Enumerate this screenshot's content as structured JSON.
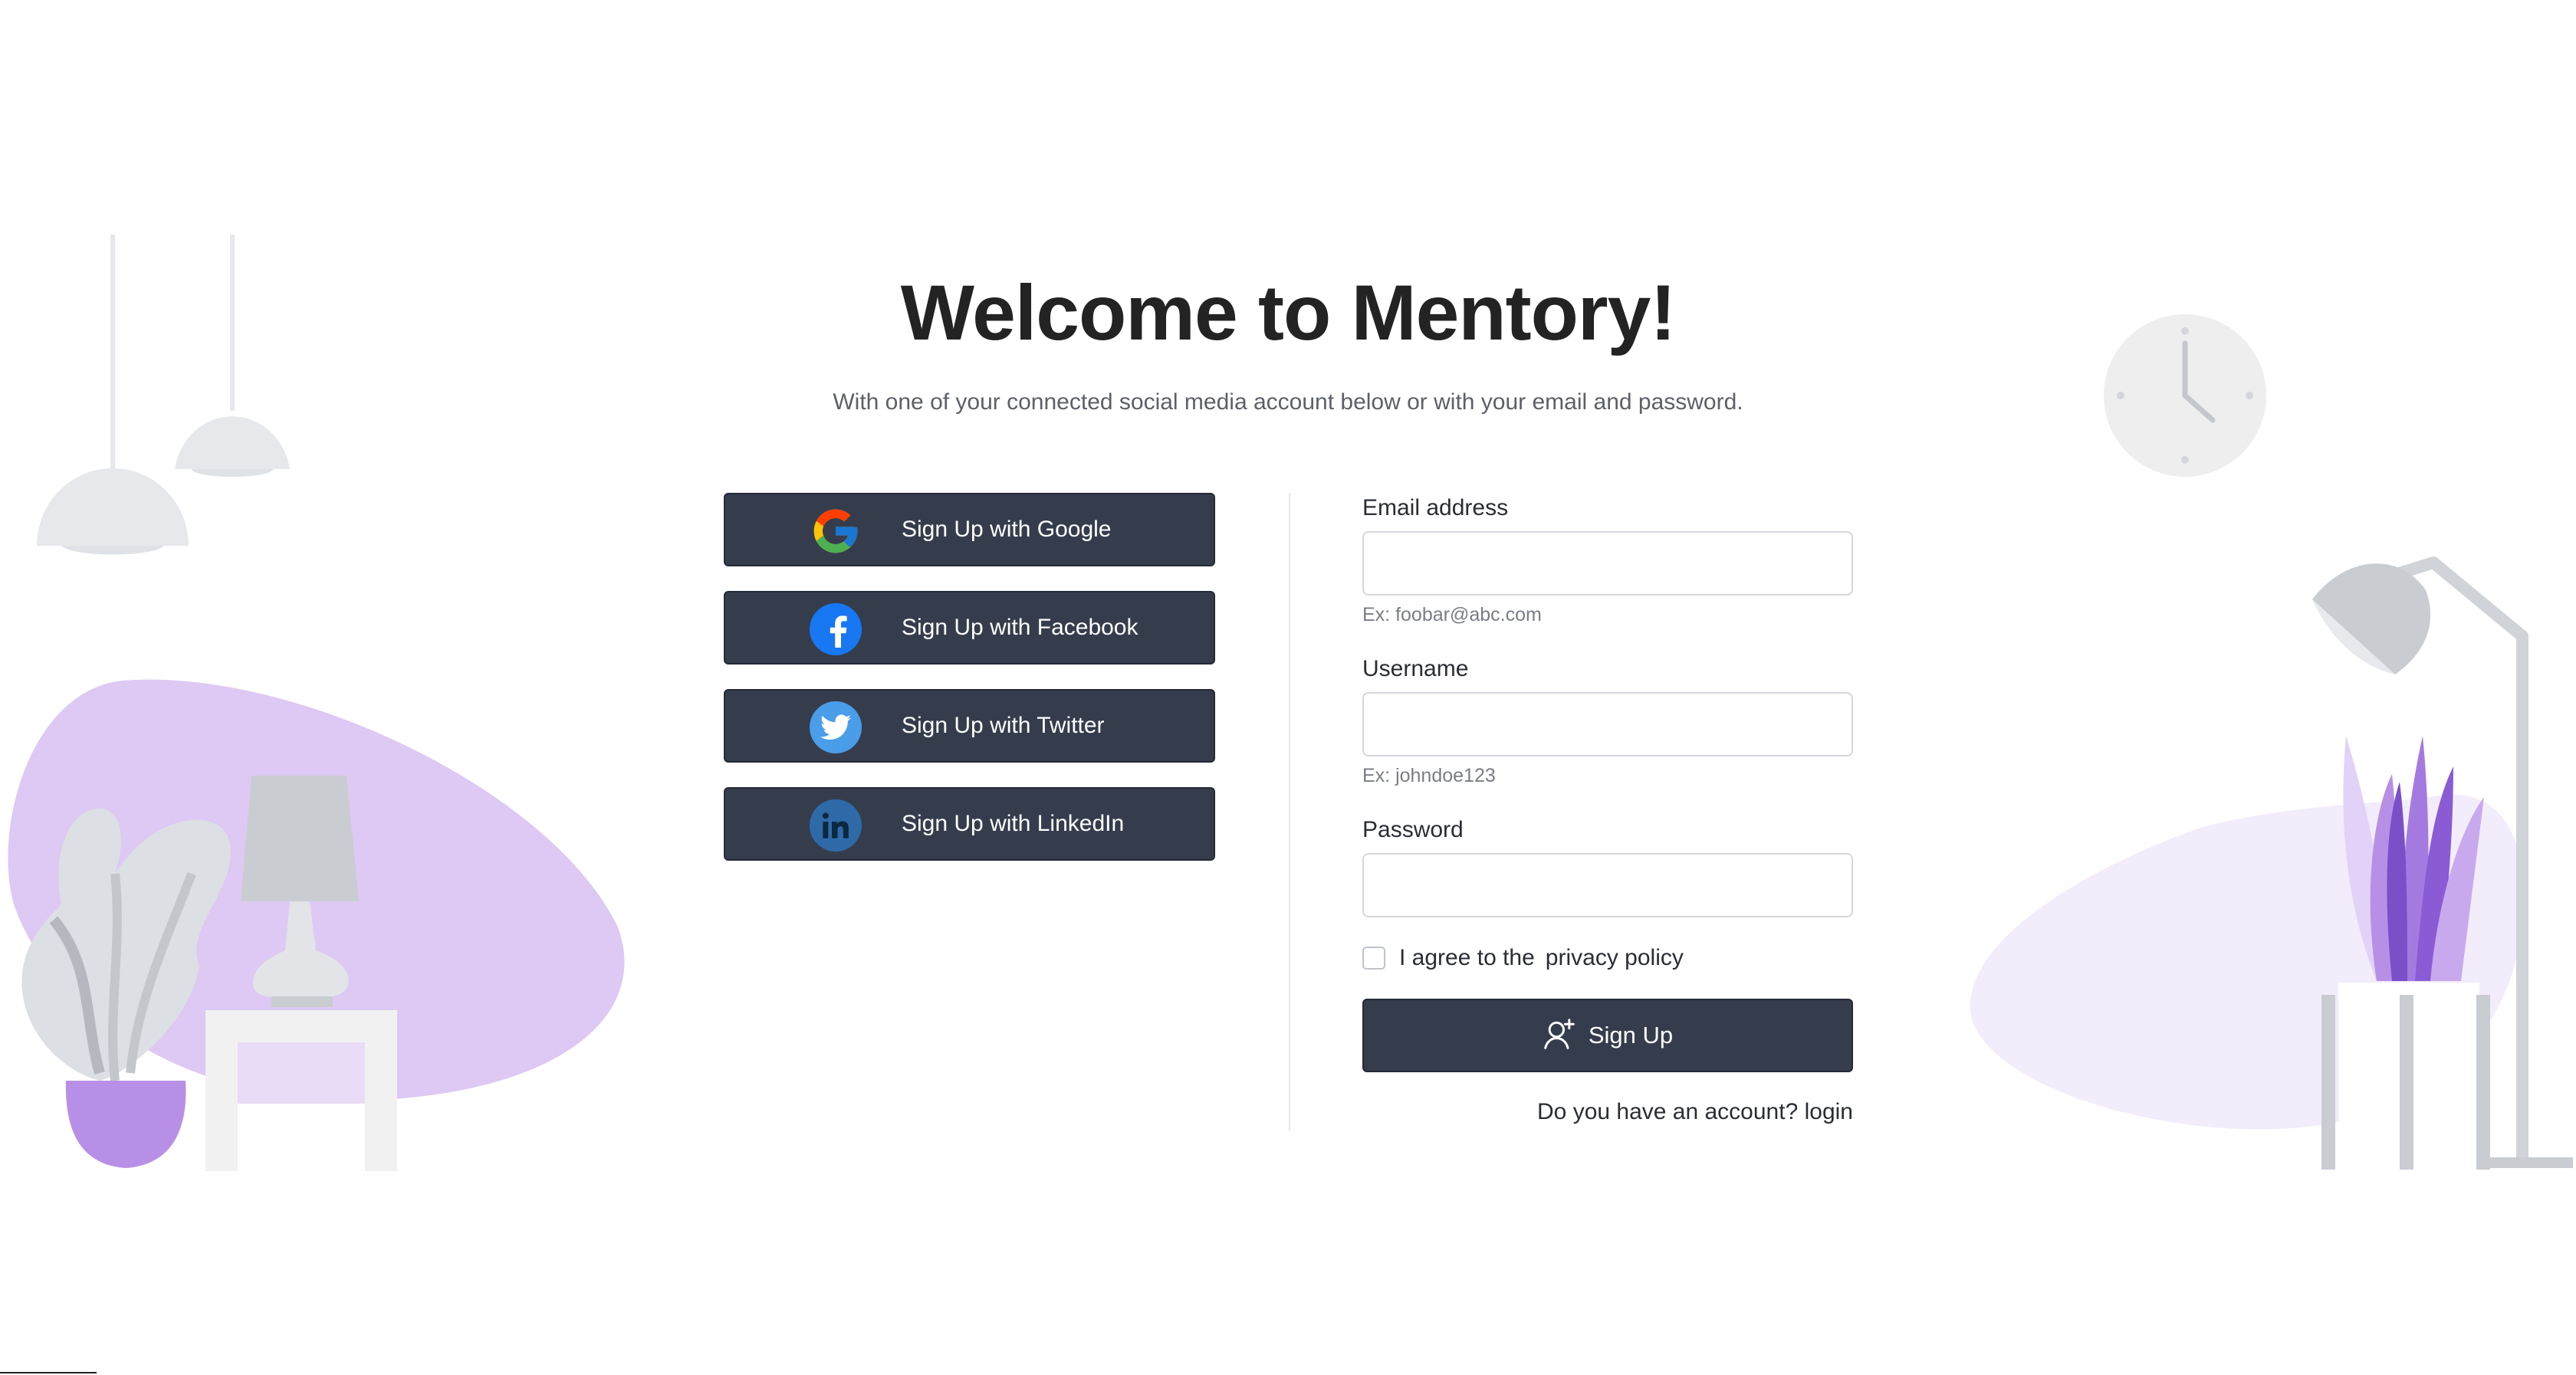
{
  "header": {
    "title": "Welcome to Mentory!",
    "subtitle": "With one of your connected social media account below or with your email and password."
  },
  "social_buttons": [
    {
      "label": "Sign Up with Google",
      "icon": "google-icon"
    },
    {
      "label": "Sign Up with Facebook",
      "icon": "facebook-icon"
    },
    {
      "label": "Sign Up with Twitter",
      "icon": "twitter-icon"
    },
    {
      "label": "Sign Up with LinkedIn",
      "icon": "linkedin-icon"
    }
  ],
  "form": {
    "email": {
      "label": "Email address",
      "value": "",
      "hint": "Ex: foobar@abc.com"
    },
    "username": {
      "label": "Username",
      "value": "",
      "hint": "Ex: johndoe123"
    },
    "password": {
      "label": "Password",
      "value": ""
    },
    "agree": {
      "text": "I agree to the",
      "link": "privacy policy",
      "checked": false
    },
    "submit_label": "Sign Up",
    "submit_icon": "user-plus-icon",
    "login_prompt": "Do you have an account?",
    "login_link": "login"
  },
  "colors": {
    "button_bg": "#353d4d",
    "accent_purple": "#b88fe6",
    "blob_purple": "#ddc9f3",
    "blob_light": "#f3ecfb",
    "decor_gray": "#e6e8eb"
  }
}
